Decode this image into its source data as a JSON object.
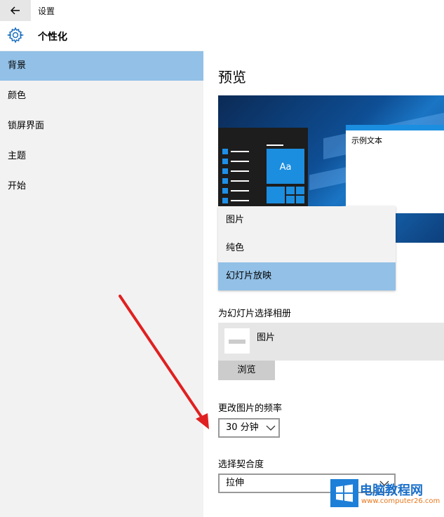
{
  "window": {
    "title": "设置"
  },
  "header": {
    "title": "个性化"
  },
  "sidebar": {
    "items": [
      {
        "label": "背景",
        "active": true
      },
      {
        "label": "颜色",
        "active": false
      },
      {
        "label": "锁屏界面",
        "active": false
      },
      {
        "label": "主题",
        "active": false
      },
      {
        "label": "开始",
        "active": false
      }
    ]
  },
  "main": {
    "preview_title": "预览",
    "preview_sample_text": "示例文本",
    "preview_tile_text": "Aa",
    "background_options": [
      {
        "label": "图片",
        "selected": false
      },
      {
        "label": "纯色",
        "selected": false
      },
      {
        "label": "幻灯片放映",
        "selected": true
      }
    ],
    "album_label": "为幻灯片选择相册",
    "album_name": "图片",
    "browse_label": "浏览",
    "frequency_label": "更改图片的频率",
    "frequency_value": "30 分钟",
    "fit_label": "选择契合度",
    "fit_value": "拉伸"
  },
  "watermark": {
    "brand": "电脑教程网",
    "url": "www.computer26.com"
  },
  "colors": {
    "accent": "#92c0e6",
    "sidebar_bg": "#f2f2f2",
    "annotation_arrow": "#e02020"
  },
  "icons": {
    "back": "back-arrow-icon",
    "settings": "gear-icon",
    "dropdown": "chevron-down-icon"
  }
}
